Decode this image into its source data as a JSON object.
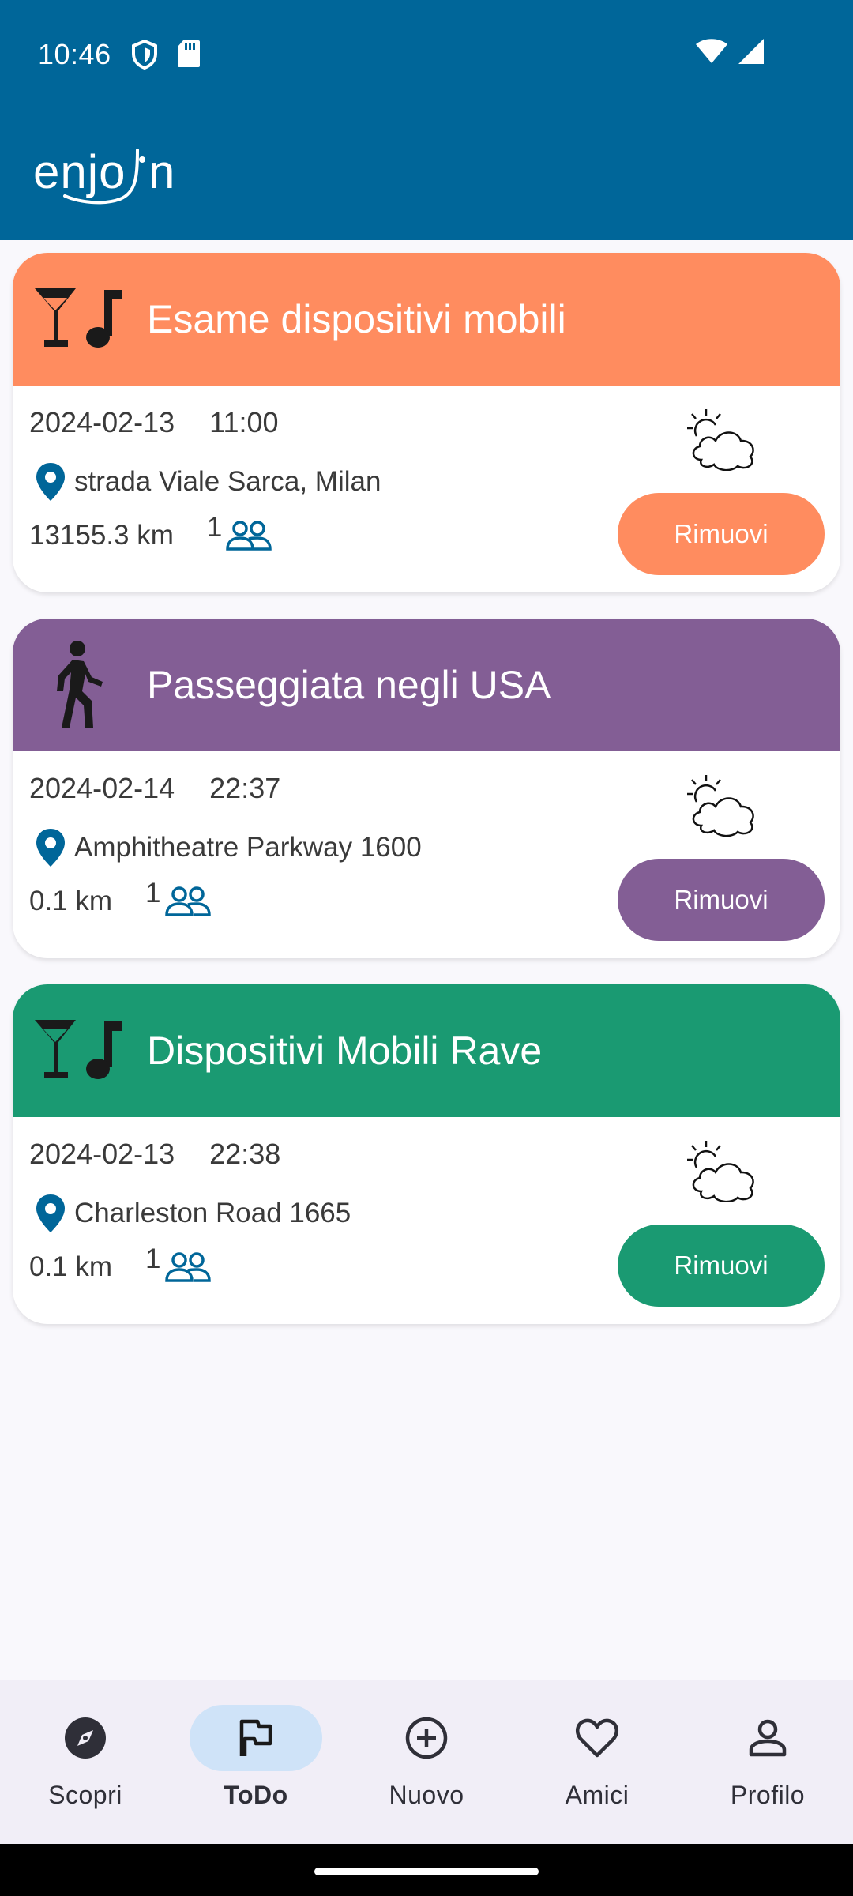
{
  "status_bar": {
    "time": "10:46"
  },
  "app": {
    "logo_text": "enjoin"
  },
  "events": [
    {
      "title": "Esame dispositivi mobili",
      "category_icon": "cocktail-music-icon",
      "color": "#ff8c5f",
      "date": "2024-02-13",
      "time": "11:00",
      "location": "strada Viale Sarca, Milan",
      "distance": "13155.3 km",
      "participants": "1",
      "weather_icon": "partly-cloudy-icon",
      "remove_label": "Rimuovi"
    },
    {
      "title": "Passeggiata negli USA",
      "category_icon": "walking-person-icon",
      "color": "#835e95",
      "date": "2024-02-14",
      "time": "22:37",
      "location": "Amphitheatre Parkway 1600",
      "distance": "0.1 km",
      "participants": "1",
      "weather_icon": "partly-cloudy-icon",
      "remove_label": "Rimuovi"
    },
    {
      "title": "Dispositivi Mobili Rave",
      "category_icon": "cocktail-music-icon",
      "color": "#1a9a72",
      "date": "2024-02-13",
      "time": "22:38",
      "location": "Charleston Road 1665",
      "distance": "0.1 km",
      "participants": "1",
      "weather_icon": "partly-cloudy-icon",
      "remove_label": "Rimuovi"
    }
  ],
  "bottom_nav": [
    {
      "label": "Scopri",
      "icon": "compass-icon",
      "active": false
    },
    {
      "label": "ToDo",
      "icon": "flag-icon",
      "active": true
    },
    {
      "label": "Nuovo",
      "icon": "add-circle-icon",
      "active": false
    },
    {
      "label": "Amici",
      "icon": "heart-icon",
      "active": false
    },
    {
      "label": "Profilo",
      "icon": "person-icon",
      "active": false
    }
  ],
  "colors": {
    "app_bar": "#006699",
    "nav_background": "#f1eef7",
    "nav_active_pill": "#cfe3f8",
    "location_pin": "#006699"
  }
}
